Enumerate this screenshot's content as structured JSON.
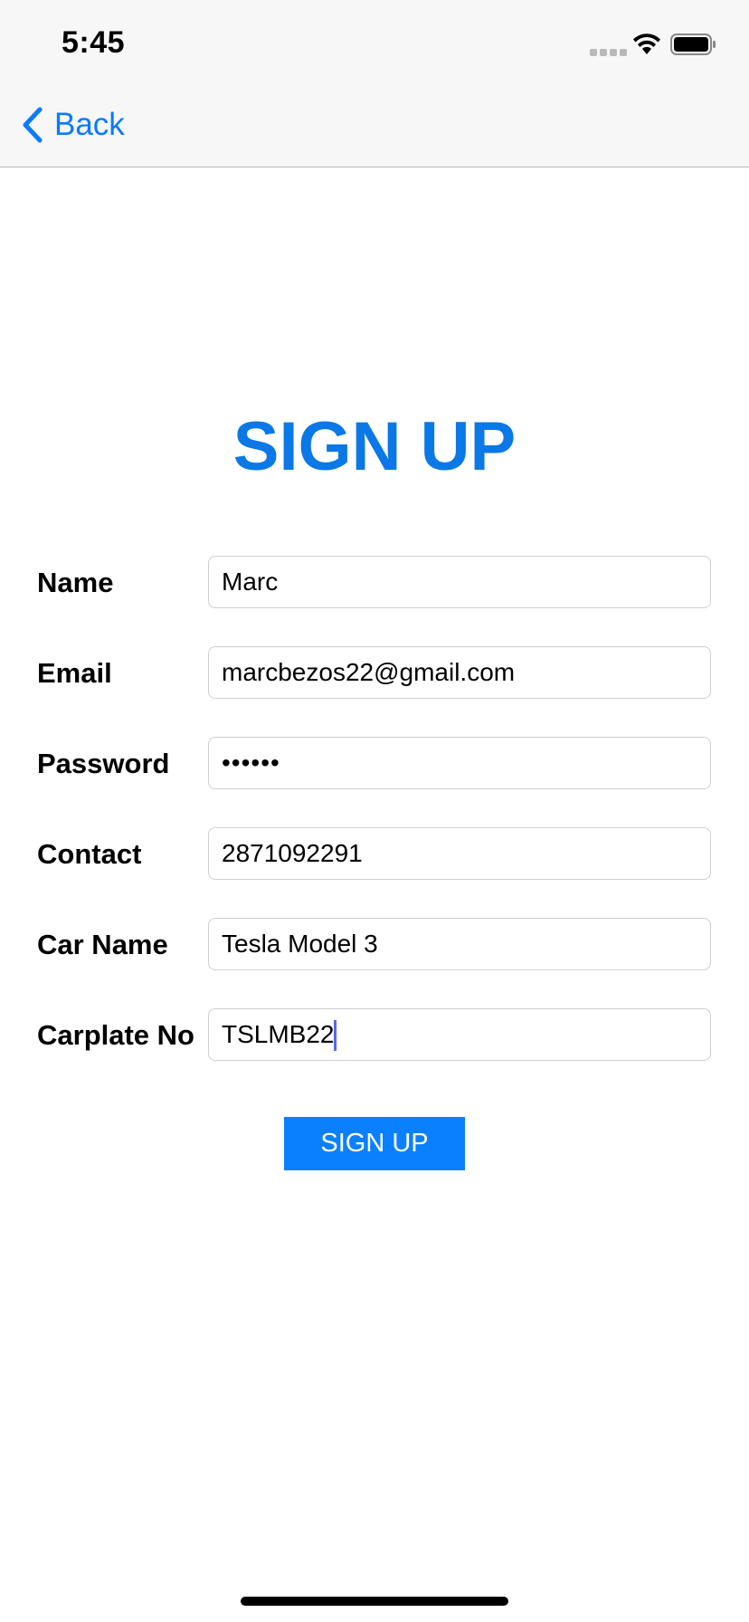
{
  "status_bar": {
    "time": "5:45"
  },
  "nav": {
    "back_label": "Back"
  },
  "page": {
    "title": "SIGN UP"
  },
  "form": {
    "fields": [
      {
        "label": "Name",
        "value": "Marc"
      },
      {
        "label": "Email",
        "value": "marcbezos22@gmail.com"
      },
      {
        "label": "Password",
        "value": "••••••"
      },
      {
        "label": "Contact",
        "value": "2871092291"
      },
      {
        "label": "Car Name",
        "value": "Tesla Model 3"
      },
      {
        "label": "Carplate No",
        "value": "TSLMB22"
      }
    ],
    "submit_label": "SIGN UP"
  },
  "colors": {
    "accent": "#0a7aff",
    "title": "#0a78e6",
    "button": "#0a80ff"
  }
}
